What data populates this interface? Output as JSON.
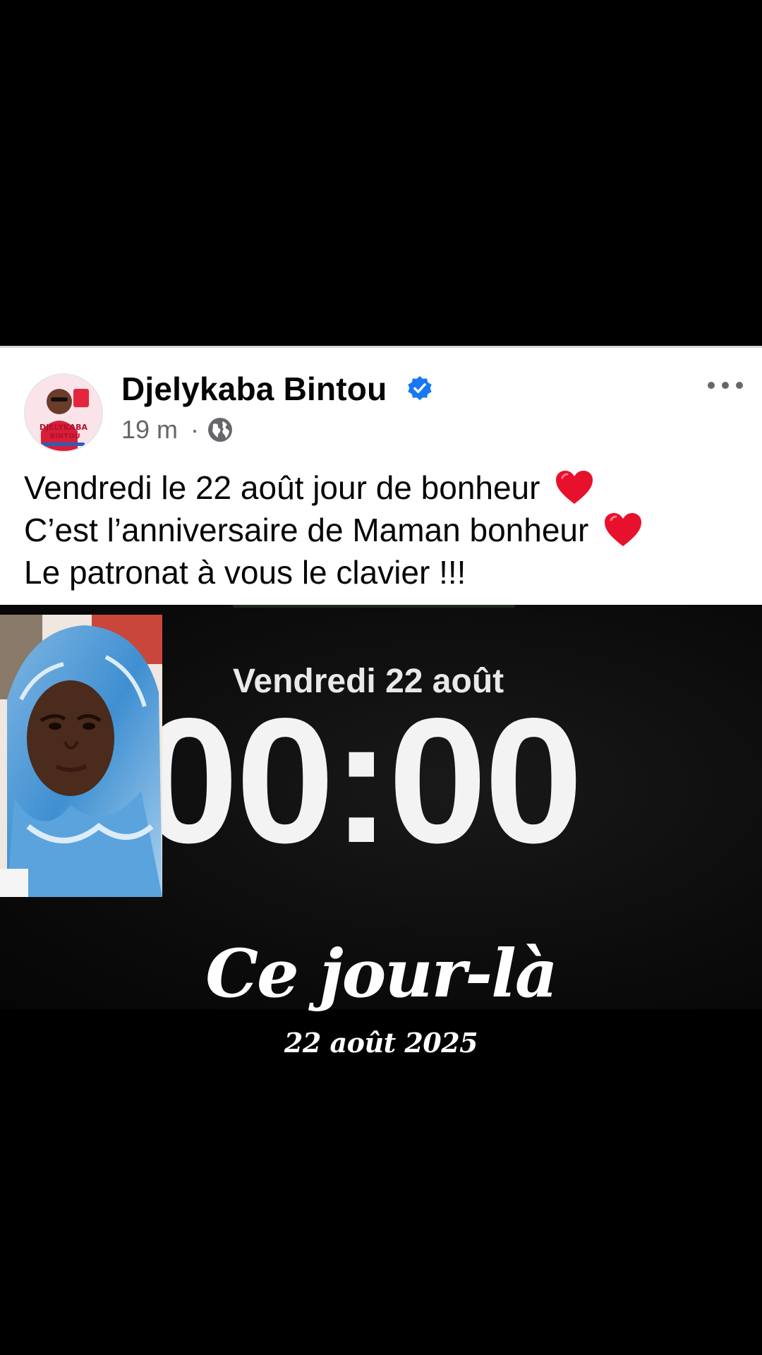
{
  "post": {
    "author_name": "Djelykaba Bintou",
    "verified": true,
    "time": "19 m",
    "time_separator": "·",
    "audience_icon": "globe-icon",
    "more_icon": "more-options-icon",
    "avatar_text": [
      "DJELYKABA",
      "BINTOU"
    ],
    "lines": [
      "Vendredi le 22 août jour de bonheur",
      "C’est l’anniversaire de Maman bonheur",
      "Le patronat à vous le clavier !!!"
    ],
    "line_emojis": [
      "heart-icon",
      "heart-icon",
      ""
    ],
    "colors": {
      "name": "#050505",
      "meta": "#65676b",
      "verified": "#1877f2",
      "heart": "#e8112d"
    }
  },
  "image": {
    "date_label": "Vendredi 22 août",
    "clock": "00:00",
    "headline": "Ce jour-là",
    "sub_date": "22 août 2025",
    "portrait_icon": "portrait-photo"
  }
}
